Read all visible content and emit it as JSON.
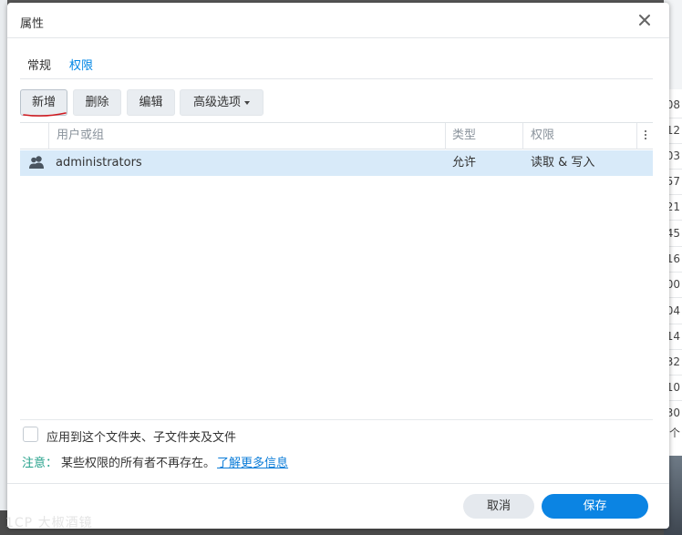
{
  "dialog": {
    "title": "属性",
    "tabs": [
      {
        "label": "常规",
        "active": false
      },
      {
        "label": "权限",
        "active": true
      }
    ]
  },
  "toolbar": {
    "add_label": "新增",
    "delete_label": "删除",
    "edit_label": "编辑",
    "advanced_label": "高级选项"
  },
  "table": {
    "headers": [
      "用户或组",
      "类型",
      "权限"
    ],
    "rows": [
      {
        "user": "administrators",
        "type": "允许",
        "permission": "读取 & 写入"
      }
    ]
  },
  "options": {
    "apply_label": "应用到这个文件夹、子文件夹及文件"
  },
  "note": {
    "label": "注意：",
    "text": "某些权限的所有者不再存在。",
    "link": "了解更多信息"
  },
  "footer": {
    "cancel_label": "取消",
    "save_label": "保存"
  },
  "background": {
    "numbers": [
      "08",
      "12",
      "03",
      "57",
      "21",
      "45",
      "16",
      "00",
      "04",
      "14",
      "32",
      "10",
      "30",
      "个"
    ]
  },
  "watermark": "1CP 大椒酒镜",
  "colors": {
    "accent": "#0086e5",
    "save_button": "#0b84e3",
    "note_label": "#23a08a",
    "selected_row": "#d8eaf9"
  }
}
